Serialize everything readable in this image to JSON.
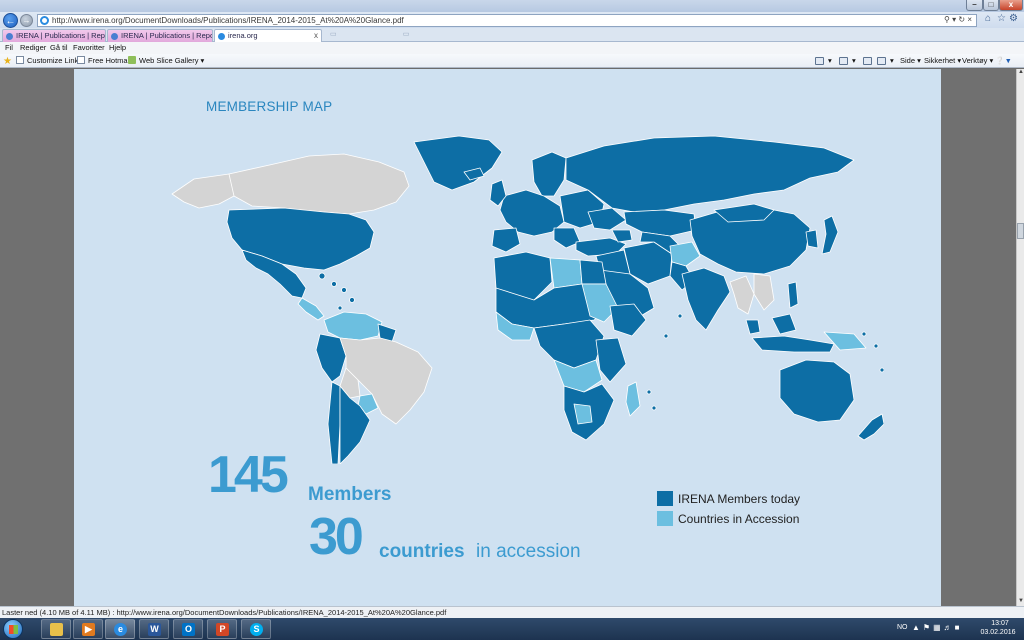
{
  "window": {
    "title": "",
    "controls": {
      "minimize": "–",
      "maximize": "□",
      "close": "x"
    }
  },
  "address_bar": {
    "url": "http://www.irena.org/DocumentDownloads/Publications/IRENA_2014-2015_At%20A%20Glance.pdf",
    "search_icon": "search-icon",
    "refresh_icon": "refresh-icon",
    "close_icon": "close-icon"
  },
  "right_icons": [
    "home-icon",
    "star-icon",
    "gear-icon",
    "smiley-icon"
  ],
  "tabs": [
    {
      "label": "IRENA | Publications | Reports ..."
    },
    {
      "label": "IRENA | Publications | Reports ..."
    },
    {
      "label": "irena.org",
      "close": "x"
    }
  ],
  "menu": [
    "Fil",
    "Rediger",
    "Gå til",
    "Favoritter",
    "Hjelp"
  ],
  "favorites": [
    "Customize Links",
    "Free Hotmail",
    "Web Slice Gallery"
  ],
  "command_bar": [
    "Side",
    "Sikkerhet",
    "Verktøy"
  ],
  "document": {
    "heading": "MEMBERSHIP MAP",
    "members_count": "145",
    "members_label": "Members",
    "accession_count": "30",
    "accession_label_bold": "countries",
    "accession_label_rest": "in accession",
    "legend": [
      {
        "label": "IRENA Members today",
        "color": "#0d6ea5"
      },
      {
        "label": "Countries in Accession",
        "color": "#6cbfe0"
      }
    ],
    "map_colors": {
      "ocean": "#cfe1f1",
      "member": "#0d6ea5",
      "accession": "#6cbfe0",
      "non_member": "#d4d4d4",
      "border": "#ffffff"
    }
  },
  "status_bar": {
    "text": "Laster ned (4.10 MB of 4.11 MB) : http://www.irena.org/DocumentDownloads/Publications/IRENA_2014-2015_At%20A%20Glance.pdf"
  },
  "taskbar": {
    "apps": [
      "explorer-icon",
      "media-player-icon",
      "internet-explorer-icon",
      "word-icon",
      "outlook-icon",
      "powerpoint-icon",
      "skype-icon"
    ],
    "language": "NO",
    "time": "13:07",
    "date": "03.02.2016"
  }
}
